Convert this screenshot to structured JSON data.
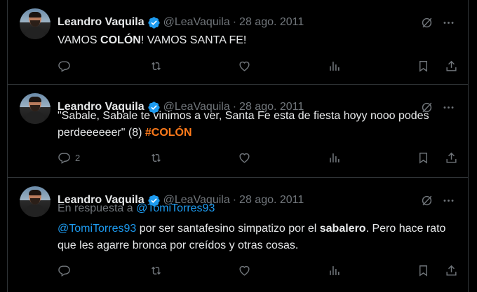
{
  "tweets": [
    {
      "author": "Leandro Vaquila",
      "handle": "@LeaVaquila",
      "date": "28 ago. 2011",
      "text": {
        "p1": "VAMOS ",
        "bold1": "COLÓN",
        "p2": "! VAMOS SANTA FE!"
      },
      "reply_count": ""
    },
    {
      "author": "Leandro Vaquila",
      "handle": "@LeaVaquila",
      "date": "28 ago. 2011",
      "text": {
        "p1": "\"Sabale, Sabale te vinimos a ver, Santa Fe esta de fiesta hoyy nooo podes perdeeeeeer\" (8) ",
        "hashtag": "#COLÓN"
      },
      "reply_count": "2"
    },
    {
      "author": "Leandro Vaquila",
      "handle": "@LeaVaquila",
      "date": "28 ago. 2011",
      "reply_prefix": "En respuesta a ",
      "reply_to": "@TomiTorres93",
      "text": {
        "mention": "@TomiTorres93",
        "p1": " por ser santafesino simpatizo por el ",
        "bold1": "sabalero",
        "p2": ". Pero hace rato que les agarre bronca por creídos y otras cosas."
      },
      "reply_count": ""
    }
  ],
  "separator": "·",
  "icons": [
    "verified-badge-icon",
    "grok-icon",
    "more-icon",
    "reply-icon",
    "retweet-icon",
    "like-icon",
    "views-icon",
    "bookmark-icon",
    "share-icon"
  ],
  "colors": {
    "background": "#000000",
    "text": "#e7e9ea",
    "muted": "#71767b",
    "link": "#1d9bf0",
    "hashtag": "#ff7a1a",
    "verified": "#1d9bf0"
  }
}
